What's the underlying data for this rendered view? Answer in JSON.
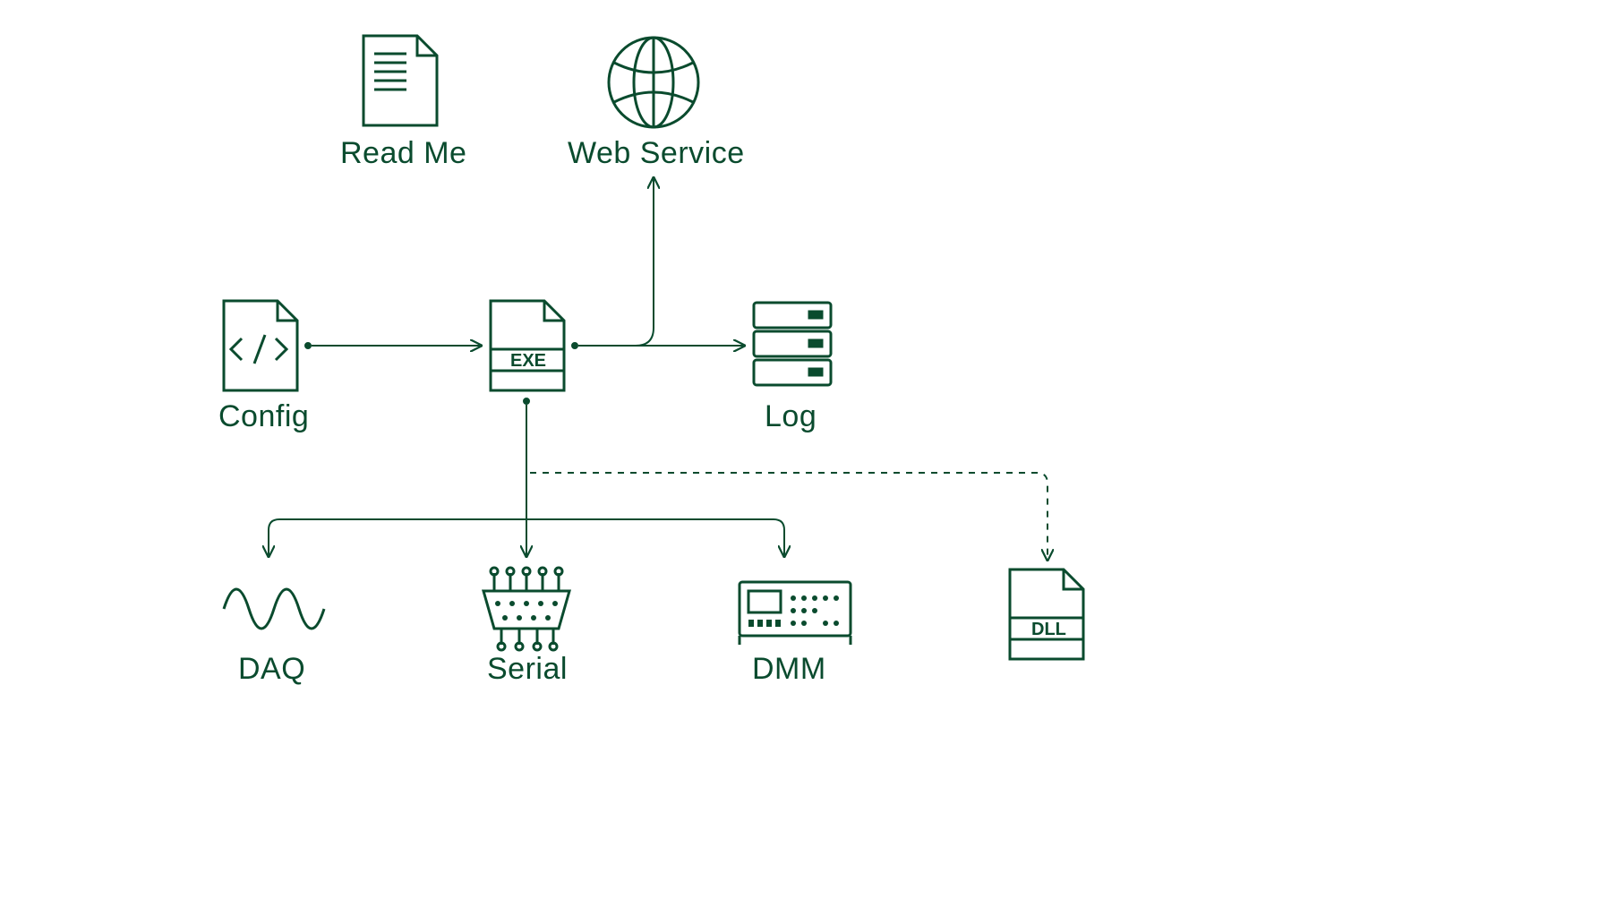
{
  "diagram": {
    "stroke": "#0a4b2e",
    "nodes": {
      "readme": {
        "label": "Read Me"
      },
      "webservice": {
        "label": "Web Service"
      },
      "config": {
        "label": "Config"
      },
      "exe": {
        "badge": "EXE"
      },
      "log": {
        "label": "Log"
      },
      "daq": {
        "label": "DAQ"
      },
      "serial": {
        "label": "Serial"
      },
      "dmm": {
        "label": "DMM"
      },
      "dll": {
        "badge": "DLL"
      }
    },
    "edges": [
      {
        "from": "config",
        "to": "exe",
        "style": "solid"
      },
      {
        "from": "exe",
        "to": "log",
        "style": "solid"
      },
      {
        "from": "exe",
        "to": "webservice",
        "style": "solid",
        "direction": "up"
      },
      {
        "from": "exe",
        "to": "daq",
        "style": "solid"
      },
      {
        "from": "exe",
        "to": "serial",
        "style": "solid"
      },
      {
        "from": "exe",
        "to": "dmm",
        "style": "solid"
      },
      {
        "from": "exe",
        "to": "dll",
        "style": "dashed"
      }
    ]
  }
}
